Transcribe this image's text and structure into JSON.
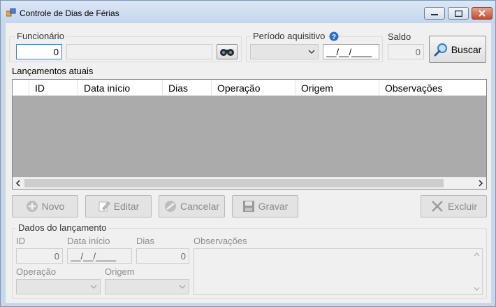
{
  "window": {
    "title": "Controle de Dias de Férias",
    "icons": {
      "app": "app-icon",
      "minimize": "minimize-icon",
      "maximize": "maximize-icon",
      "close": "close-icon"
    }
  },
  "search": {
    "funcionario_label": "Funcionário",
    "funcionario_id": "0",
    "funcionario_nome": "",
    "search_icon": "binoculars-icon",
    "periodo_label": "Período aquisitivo",
    "help_icon": "help-icon",
    "periodo_combo": "",
    "periodo_date": "__/__/____",
    "saldo_label": "Saldo",
    "saldo_value": "0",
    "buscar_label": "Buscar",
    "buscar_icon": "magnifier-icon"
  },
  "grid": {
    "title": "Lançamentos atuais",
    "columns": [
      "ID",
      "Data início",
      "Dias",
      "Operação",
      "Origem",
      "Observações"
    ],
    "rows": []
  },
  "actions": {
    "novo": "Novo",
    "editar": "Editar",
    "cancelar": "Cancelar",
    "gravar": "Gravar",
    "excluir": "Excluir"
  },
  "details": {
    "group_title": "Dados do lançamento",
    "id_label": "ID",
    "id_value": "0",
    "data_label": "Data início",
    "data_value": "__/__/____",
    "dias_label": "Dias",
    "dias_value": "0",
    "obs_label": "Observações",
    "obs_value": "",
    "operacao_label": "Operação",
    "operacao_value": "",
    "origem_label": "Origem",
    "origem_value": ""
  },
  "colors": {
    "titlebar": "#c5d6ec",
    "client_background": "#f0f0f0",
    "grid_background": "#ababab",
    "close_button": "#c44b30"
  }
}
